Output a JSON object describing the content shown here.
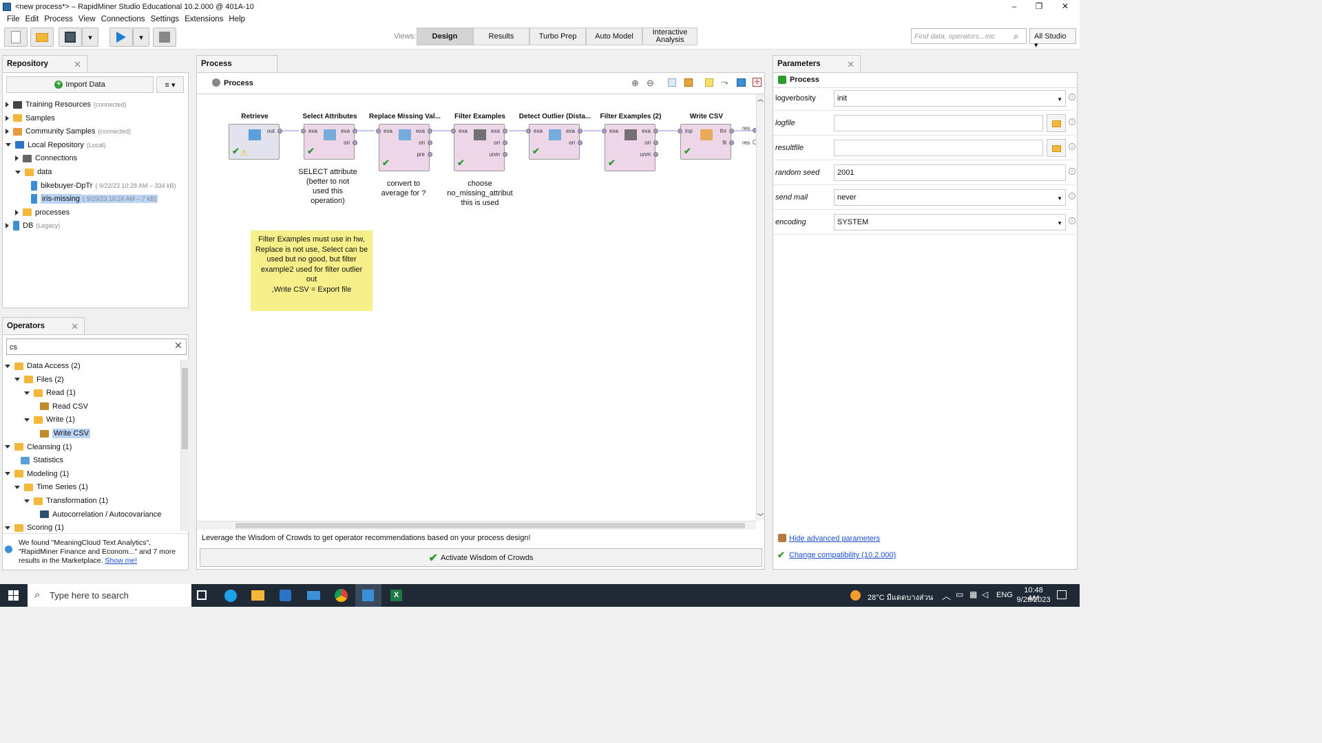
{
  "window": {
    "title": "<new process*> – RapidMiner Studio Educational 10.2.000 @ 401A-10",
    "controls": {
      "min": "–",
      "max": "❐",
      "close": "✕"
    }
  },
  "menu": [
    "File",
    "Edit",
    "Process",
    "View",
    "Connections",
    "Settings",
    "Extensions",
    "Help"
  ],
  "toolbar": {
    "views_label": "Views:",
    "views": [
      {
        "label": "Design",
        "active": true
      },
      {
        "label": "Results"
      },
      {
        "label": "Turbo Prep"
      },
      {
        "label": "Auto Model"
      },
      {
        "label": "Interactive Analysis"
      }
    ],
    "search_placeholder": "Find data, operators...etc",
    "studio": "All Studio ▾"
  },
  "repository": {
    "tab": "Repository",
    "import_button": "Import Data",
    "items": [
      {
        "label": "Training Resources",
        "note": "(connected)",
        "indent": 0,
        "exp": "r",
        "icon": "hat"
      },
      {
        "label": "Samples",
        "indent": 0,
        "exp": "r",
        "icon": "folder"
      },
      {
        "label": "Community Samples",
        "note": "(connected)",
        "indent": 0,
        "exp": "r",
        "icon": "people"
      },
      {
        "label": "Local Repository",
        "note": "(Local)",
        "indent": 0,
        "exp": "d",
        "icon": "monitor"
      },
      {
        "label": "Connections",
        "indent": 1,
        "exp": "r",
        "icon": "plug"
      },
      {
        "label": "data",
        "indent": 1,
        "exp": "d",
        "icon": "folder"
      },
      {
        "label": "bikebuyer-DpTr",
        "note": "( 9/22/23 10:28 AM – 334 kB)",
        "indent": 2,
        "icon": "data"
      },
      {
        "label": "iris-missing",
        "note": "( 9/29/23 10:24 AM – 7 kB)",
        "indent": 2,
        "icon": "data",
        "selected": true
      },
      {
        "label": "processes",
        "indent": 1,
        "exp": "r",
        "icon": "folder"
      },
      {
        "label": "DB",
        "note": "(Legacy)",
        "indent": 0,
        "exp": "r",
        "icon": "db"
      }
    ]
  },
  "operators": {
    "tab": "Operators",
    "search_value": "cs",
    "items": [
      {
        "label": "Data Access (2)",
        "indent": 0,
        "exp": "d",
        "icon": "folder"
      },
      {
        "label": "Files (2)",
        "indent": 1,
        "exp": "d",
        "icon": "folder"
      },
      {
        "label": "Read (1)",
        "indent": 2,
        "exp": "d",
        "icon": "folder"
      },
      {
        "label": "Read CSV",
        "indent": 3,
        "icon": "read"
      },
      {
        "label": "Write (1)",
        "indent": 2,
        "exp": "d",
        "icon": "folder"
      },
      {
        "label": "Write CSV",
        "indent": 3,
        "icon": "write",
        "selected": true
      },
      {
        "label": "Cleansing (1)",
        "indent": 0,
        "exp": "d",
        "icon": "folder"
      },
      {
        "label": "Statistics",
        "indent": 1,
        "icon": "stats"
      },
      {
        "label": "Modeling (1)",
        "indent": 0,
        "exp": "d",
        "icon": "folder"
      },
      {
        "label": "Time Series (1)",
        "indent": 1,
        "exp": "d",
        "icon": "folder"
      },
      {
        "label": "Transformation (1)",
        "indent": 2,
        "exp": "d",
        "icon": "folder"
      },
      {
        "label": "Autocorrelation / Autocovariance",
        "indent": 3,
        "icon": "chart"
      },
      {
        "label": "Scoring (1)",
        "indent": 0,
        "exp": "d",
        "icon": "folder"
      }
    ],
    "marketplace": {
      "text": "We found \"MeaningCloud Text Analytics\", \"RapidMiner Finance and Econom...\" and 7 more results in the Marketplace.",
      "link": "Show me!"
    }
  },
  "process": {
    "tab": "Process",
    "breadcrumb": "Process",
    "operators": [
      {
        "name": "Retrieve",
        "in": [],
        "out": [
          "out"
        ]
      },
      {
        "name": "Select Attributes",
        "in": [
          "exa"
        ],
        "out": [
          "exa",
          "ori"
        ]
      },
      {
        "name": "Replace Missing Val...",
        "in": [
          "exa"
        ],
        "out": [
          "exa",
          "ori",
          "pre"
        ]
      },
      {
        "name": "Filter Examples",
        "in": [
          "exa"
        ],
        "out": [
          "exa",
          "ori",
          "unm"
        ]
      },
      {
        "name": "Detect Outlier (Dista...",
        "in": [
          "exa"
        ],
        "out": [
          "exa",
          "ori"
        ]
      },
      {
        "name": "Filter Examples (2)",
        "in": [
          "exa"
        ],
        "out": [
          "exa",
          "ori",
          "unm"
        ]
      },
      {
        "name": "Write CSV",
        "in": [
          "inp"
        ],
        "out": [
          "thr",
          "fil"
        ]
      }
    ],
    "result_ports": [
      "res",
      "res"
    ],
    "annotations": [
      {
        "text": "SELECT attribute\n(better to not\nused this\noperation)"
      },
      {
        "text": "convert to\naverage for ?"
      },
      {
        "text": "choose\nno_missing_attribut\nthis is used"
      }
    ],
    "sticky_note": "Filter Examples must use in hw,\nReplace is not use, Select can be\nused but no good, but filter\nexample2 used for filter outlier\nout\n,Write CSV = Export file",
    "wisdom_text": "Leverage the Wisdom of Crowds to get operator recommendations based on your process design!",
    "wisdom_button": "Activate Wisdom of Crowds"
  },
  "parameters": {
    "tab": "Parameters",
    "heading": "Process",
    "rows": [
      {
        "label": "logverbosity",
        "value": "init",
        "type": "dropdown"
      },
      {
        "label": "logfile",
        "value": "",
        "type": "file"
      },
      {
        "label": "resultfile",
        "value": "",
        "type": "file"
      },
      {
        "label": "random seed",
        "value": "2001",
        "type": "text"
      },
      {
        "label": "send mail",
        "value": "never",
        "type": "dropdown"
      },
      {
        "label": "encoding",
        "value": "SYSTEM",
        "type": "dropdown"
      }
    ],
    "hide_link": "Hide advanced parameters",
    "compat_link": "Change compatibility (10.2.000)"
  },
  "taskbar": {
    "search_placeholder": "Type here to search",
    "weather": "28°C มีแดดบางส่วน",
    "lang": "ENG",
    "time": "10:48 AM",
    "date": "9/29/2023"
  }
}
